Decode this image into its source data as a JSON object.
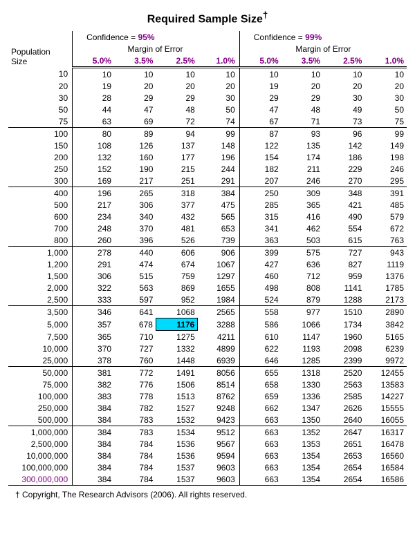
{
  "title": "Required Sample Size",
  "title_dagger": "†",
  "confidence_label": "Confidence = ",
  "blocks": [
    {
      "confidence": "95%",
      "margin_label": "Margin of Error",
      "moe": [
        "5.0%",
        "3.5%",
        "2.5%",
        "1.0%"
      ]
    },
    {
      "confidence": "99%",
      "margin_label": "Margin of Error",
      "moe": [
        "5.0%",
        "3.5%",
        "2.5%",
        "1.0%"
      ]
    }
  ],
  "population_label": "Population Size",
  "groups": [
    {
      "rows": [
        {
          "p": "10",
          "v": [
            "10",
            "10",
            "10",
            "10",
            "10",
            "10",
            "10",
            "10"
          ]
        },
        {
          "p": "20",
          "v": [
            "19",
            "20",
            "20",
            "20",
            "19",
            "20",
            "20",
            "20"
          ]
        },
        {
          "p": "30",
          "v": [
            "28",
            "29",
            "29",
            "30",
            "29",
            "29",
            "30",
            "30"
          ]
        },
        {
          "p": "50",
          "v": [
            "44",
            "47",
            "48",
            "50",
            "47",
            "48",
            "49",
            "50"
          ]
        },
        {
          "p": "75",
          "v": [
            "63",
            "69",
            "72",
            "74",
            "67",
            "71",
            "73",
            "75"
          ]
        }
      ]
    },
    {
      "rows": [
        {
          "p": "100",
          "v": [
            "80",
            "89",
            "94",
            "99",
            "87",
            "93",
            "96",
            "99"
          ]
        },
        {
          "p": "150",
          "v": [
            "108",
            "126",
            "137",
            "148",
            "122",
            "135",
            "142",
            "149"
          ]
        },
        {
          "p": "200",
          "v": [
            "132",
            "160",
            "177",
            "196",
            "154",
            "174",
            "186",
            "198"
          ]
        },
        {
          "p": "250",
          "v": [
            "152",
            "190",
            "215",
            "244",
            "182",
            "211",
            "229",
            "246"
          ]
        },
        {
          "p": "300",
          "v": [
            "169",
            "217",
            "251",
            "291",
            "207",
            "246",
            "270",
            "295"
          ]
        }
      ]
    },
    {
      "rows": [
        {
          "p": "400",
          "v": [
            "196",
            "265",
            "318",
            "384",
            "250",
            "309",
            "348",
            "391"
          ]
        },
        {
          "p": "500",
          "v": [
            "217",
            "306",
            "377",
            "475",
            "285",
            "365",
            "421",
            "485"
          ]
        },
        {
          "p": "600",
          "v": [
            "234",
            "340",
            "432",
            "565",
            "315",
            "416",
            "490",
            "579"
          ]
        },
        {
          "p": "700",
          "v": [
            "248",
            "370",
            "481",
            "653",
            "341",
            "462",
            "554",
            "672"
          ]
        },
        {
          "p": "800",
          "v": [
            "260",
            "396",
            "526",
            "739",
            "363",
            "503",
            "615",
            "763"
          ]
        }
      ]
    },
    {
      "rows": [
        {
          "p": "1,000",
          "v": [
            "278",
            "440",
            "606",
            "906",
            "399",
            "575",
            "727",
            "943"
          ]
        },
        {
          "p": "1,200",
          "v": [
            "291",
            "474",
            "674",
            "1067",
            "427",
            "636",
            "827",
            "1119"
          ]
        },
        {
          "p": "1,500",
          "v": [
            "306",
            "515",
            "759",
            "1297",
            "460",
            "712",
            "959",
            "1376"
          ]
        },
        {
          "p": "2,000",
          "v": [
            "322",
            "563",
            "869",
            "1655",
            "498",
            "808",
            "1141",
            "1785"
          ]
        },
        {
          "p": "2,500",
          "v": [
            "333",
            "597",
            "952",
            "1984",
            "524",
            "879",
            "1288",
            "2173"
          ]
        }
      ]
    },
    {
      "rows": [
        {
          "p": "3,500",
          "v": [
            "346",
            "641",
            "1068",
            "2565",
            "558",
            "977",
            "1510",
            "2890"
          ]
        },
        {
          "p": "5,000",
          "v": [
            "357",
            "678",
            "1176",
            "3288",
            "586",
            "1066",
            "1734",
            "3842"
          ],
          "highlight_col": 2
        },
        {
          "p": "7,500",
          "v": [
            "365",
            "710",
            "1275",
            "4211",
            "610",
            "1147",
            "1960",
            "5165"
          ]
        },
        {
          "p": "10,000",
          "v": [
            "370",
            "727",
            "1332",
            "4899",
            "622",
            "1193",
            "2098",
            "6239"
          ]
        },
        {
          "p": "25,000",
          "v": [
            "378",
            "760",
            "1448",
            "6939",
            "646",
            "1285",
            "2399",
            "9972"
          ]
        }
      ]
    },
    {
      "rows": [
        {
          "p": "50,000",
          "v": [
            "381",
            "772",
            "1491",
            "8056",
            "655",
            "1318",
            "2520",
            "12455"
          ]
        },
        {
          "p": "75,000",
          "v": [
            "382",
            "776",
            "1506",
            "8514",
            "658",
            "1330",
            "2563",
            "13583"
          ]
        },
        {
          "p": "100,000",
          "v": [
            "383",
            "778",
            "1513",
            "8762",
            "659",
            "1336",
            "2585",
            "14227"
          ]
        },
        {
          "p": "250,000",
          "v": [
            "384",
            "782",
            "1527",
            "9248",
            "662",
            "1347",
            "2626",
            "15555"
          ]
        },
        {
          "p": "500,000",
          "v": [
            "384",
            "783",
            "1532",
            "9423",
            "663",
            "1350",
            "2640",
            "16055"
          ]
        }
      ]
    },
    {
      "rows": [
        {
          "p": "1,000,000",
          "v": [
            "384",
            "783",
            "1534",
            "9512",
            "663",
            "1352",
            "2647",
            "16317"
          ]
        },
        {
          "p": "2,500,000",
          "v": [
            "384",
            "784",
            "1536",
            "9567",
            "663",
            "1353",
            "2651",
            "16478"
          ]
        },
        {
          "p": "10,000,000",
          "v": [
            "384",
            "784",
            "1536",
            "9594",
            "663",
            "1354",
            "2653",
            "16560"
          ]
        },
        {
          "p": "100,000,000",
          "v": [
            "384",
            "784",
            "1537",
            "9603",
            "663",
            "1354",
            "2654",
            "16584"
          ]
        },
        {
          "p": "300,000,000",
          "v": [
            "384",
            "784",
            "1537",
            "9603",
            "663",
            "1354",
            "2654",
            "16586"
          ],
          "pop_highlight": true
        }
      ]
    }
  ],
  "footer": "† Copyright, The Research Advisors (2006). All rights reserved.",
  "chart_data": {
    "type": "table",
    "title": "Required Sample Size",
    "row_label": "Population Size",
    "column_groups": [
      {
        "confidence": "95%",
        "margin_of_error": [
          "5.0%",
          "3.5%",
          "2.5%",
          "1.0%"
        ]
      },
      {
        "confidence": "99%",
        "margin_of_error": [
          "5.0%",
          "3.5%",
          "2.5%",
          "1.0%"
        ]
      }
    ],
    "rows": [
      {
        "population": 10,
        "c95": [
          10,
          10,
          10,
          10
        ],
        "c99": [
          10,
          10,
          10,
          10
        ]
      },
      {
        "population": 20,
        "c95": [
          19,
          20,
          20,
          20
        ],
        "c99": [
          19,
          20,
          20,
          20
        ]
      },
      {
        "population": 30,
        "c95": [
          28,
          29,
          29,
          30
        ],
        "c99": [
          29,
          29,
          30,
          30
        ]
      },
      {
        "population": 50,
        "c95": [
          44,
          47,
          48,
          50
        ],
        "c99": [
          47,
          48,
          49,
          50
        ]
      },
      {
        "population": 75,
        "c95": [
          63,
          69,
          72,
          74
        ],
        "c99": [
          67,
          71,
          73,
          75
        ]
      },
      {
        "population": 100,
        "c95": [
          80,
          89,
          94,
          99
        ],
        "c99": [
          87,
          93,
          96,
          99
        ]
      },
      {
        "population": 150,
        "c95": [
          108,
          126,
          137,
          148
        ],
        "c99": [
          122,
          135,
          142,
          149
        ]
      },
      {
        "population": 200,
        "c95": [
          132,
          160,
          177,
          196
        ],
        "c99": [
          154,
          174,
          186,
          198
        ]
      },
      {
        "population": 250,
        "c95": [
          152,
          190,
          215,
          244
        ],
        "c99": [
          182,
          211,
          229,
          246
        ]
      },
      {
        "population": 300,
        "c95": [
          169,
          217,
          251,
          291
        ],
        "c99": [
          207,
          246,
          270,
          295
        ]
      },
      {
        "population": 400,
        "c95": [
          196,
          265,
          318,
          384
        ],
        "c99": [
          250,
          309,
          348,
          391
        ]
      },
      {
        "population": 500,
        "c95": [
          217,
          306,
          377,
          475
        ],
        "c99": [
          285,
          365,
          421,
          485
        ]
      },
      {
        "population": 600,
        "c95": [
          234,
          340,
          432,
          565
        ],
        "c99": [
          315,
          416,
          490,
          579
        ]
      },
      {
        "population": 700,
        "c95": [
          248,
          370,
          481,
          653
        ],
        "c99": [
          341,
          462,
          554,
          672
        ]
      },
      {
        "population": 800,
        "c95": [
          260,
          396,
          526,
          739
        ],
        "c99": [
          363,
          503,
          615,
          763
        ]
      },
      {
        "population": 1000,
        "c95": [
          278,
          440,
          606,
          906
        ],
        "c99": [
          399,
          575,
          727,
          943
        ]
      },
      {
        "population": 1200,
        "c95": [
          291,
          474,
          674,
          1067
        ],
        "c99": [
          427,
          636,
          827,
          1119
        ]
      },
      {
        "population": 1500,
        "c95": [
          306,
          515,
          759,
          1297
        ],
        "c99": [
          460,
          712,
          959,
          1376
        ]
      },
      {
        "population": 2000,
        "c95": [
          322,
          563,
          869,
          1655
        ],
        "c99": [
          498,
          808,
          1141,
          1785
        ]
      },
      {
        "population": 2500,
        "c95": [
          333,
          597,
          952,
          1984
        ],
        "c99": [
          524,
          879,
          1288,
          2173
        ]
      },
      {
        "population": 3500,
        "c95": [
          346,
          641,
          1068,
          2565
        ],
        "c99": [
          558,
          977,
          1510,
          2890
        ]
      },
      {
        "population": 5000,
        "c95": [
          357,
          678,
          1176,
          3288
        ],
        "c99": [
          586,
          1066,
          1734,
          3842
        ]
      },
      {
        "population": 7500,
        "c95": [
          365,
          710,
          1275,
          4211
        ],
        "c99": [
          610,
          1147,
          1960,
          5165
        ]
      },
      {
        "population": 10000,
        "c95": [
          370,
          727,
          1332,
          4899
        ],
        "c99": [
          622,
          1193,
          2098,
          6239
        ]
      },
      {
        "population": 25000,
        "c95": [
          378,
          760,
          1448,
          6939
        ],
        "c99": [
          646,
          1285,
          2399,
          9972
        ]
      },
      {
        "population": 50000,
        "c95": [
          381,
          772,
          1491,
          8056
        ],
        "c99": [
          655,
          1318,
          2520,
          12455
        ]
      },
      {
        "population": 75000,
        "c95": [
          382,
          776,
          1506,
          8514
        ],
        "c99": [
          658,
          1330,
          2563,
          13583
        ]
      },
      {
        "population": 100000,
        "c95": [
          383,
          778,
          1513,
          8762
        ],
        "c99": [
          659,
          1336,
          2585,
          14227
        ]
      },
      {
        "population": 250000,
        "c95": [
          384,
          782,
          1527,
          9248
        ],
        "c99": [
          662,
          1347,
          2626,
          15555
        ]
      },
      {
        "population": 500000,
        "c95": [
          384,
          783,
          1532,
          9423
        ],
        "c99": [
          663,
          1350,
          2640,
          16055
        ]
      },
      {
        "population": 1000000,
        "c95": [
          384,
          783,
          1534,
          9512
        ],
        "c99": [
          663,
          1352,
          2647,
          16317
        ]
      },
      {
        "population": 2500000,
        "c95": [
          384,
          784,
          1536,
          9567
        ],
        "c99": [
          663,
          1353,
          2651,
          16478
        ]
      },
      {
        "population": 10000000,
        "c95": [
          384,
          784,
          1536,
          9594
        ],
        "c99": [
          663,
          1354,
          2653,
          16560
        ]
      },
      {
        "population": 100000000,
        "c95": [
          384,
          784,
          1537,
          9603
        ],
        "c99": [
          663,
          1354,
          2654,
          16584
        ]
      },
      {
        "population": 300000000,
        "c95": [
          384,
          784,
          1537,
          9603
        ],
        "c99": [
          663,
          1354,
          2654,
          16586
        ]
      }
    ],
    "highlighted_cell": {
      "population": 5000,
      "confidence": "95%",
      "margin": "2.5%",
      "value": 1176
    }
  }
}
